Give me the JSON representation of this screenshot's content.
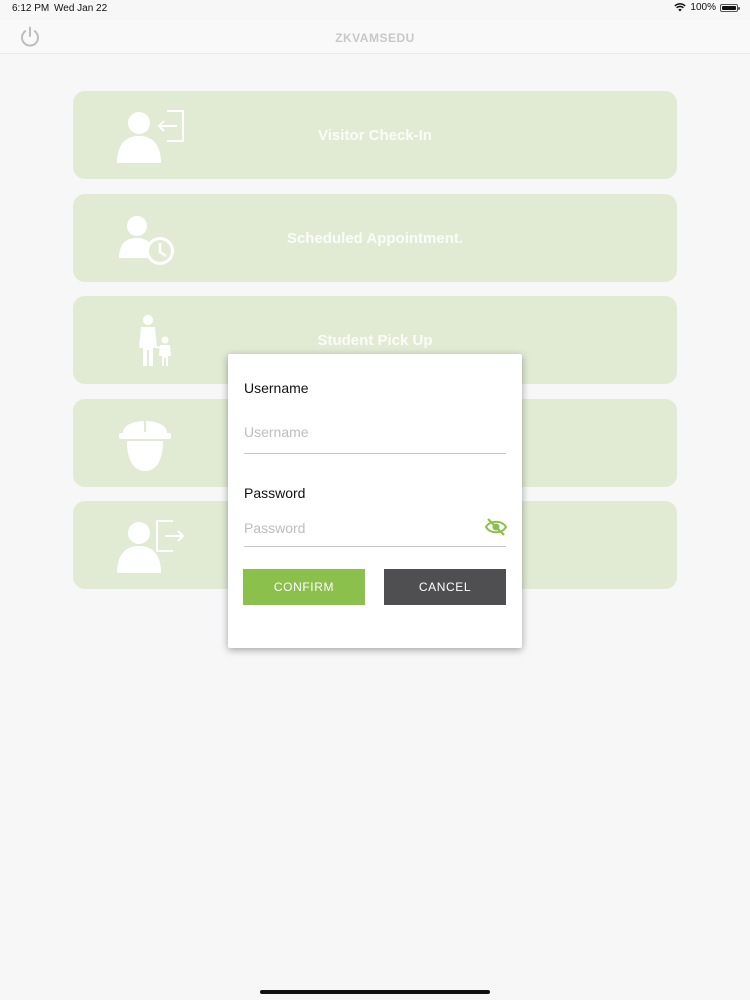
{
  "status_bar": {
    "time": "6:12 PM",
    "date": "Wed Jan 22",
    "battery": "100%"
  },
  "navbar": {
    "logo_text": "ZKVAMSEDU"
  },
  "menu": {
    "items": [
      {
        "label": "Visitor Check-In",
        "icon": "visitor-checkin-icon"
      },
      {
        "label": "Scheduled Appointment.",
        "icon": "scheduled-appointment-icon"
      },
      {
        "label": "Student Pick Up",
        "icon": "student-pickup-icon"
      },
      {
        "label": "",
        "icon": "contractor-helmet-icon"
      },
      {
        "label": "",
        "icon": "visitor-checkout-icon"
      }
    ]
  },
  "dialog": {
    "username_label": "Username",
    "username_placeholder": "Username",
    "username_value": "",
    "password_label": "Password",
    "password_placeholder": "Password",
    "password_value": "",
    "confirm_label": "CONFIRM",
    "cancel_label": "CANCEL"
  },
  "colors": {
    "card_background": "#e1ebd4",
    "accent_green": "#8bc04c",
    "cancel_gray": "#4f4f51"
  }
}
